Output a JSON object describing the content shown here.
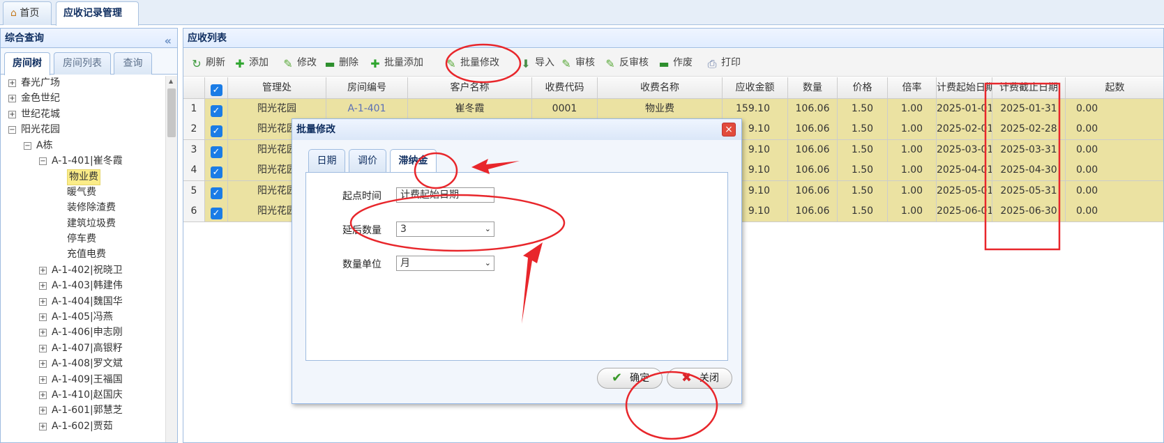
{
  "top_tabs": [
    {
      "label": "首页",
      "icon": "home-icon"
    },
    {
      "label": "应收记录管理",
      "close": "×"
    }
  ],
  "left": {
    "title": "综合查询",
    "collapse": "«",
    "tabs": [
      "房间树",
      "房间列表",
      "查询"
    ],
    "tree": [
      {
        "label": "春光广场",
        "toggle": "+"
      },
      {
        "label": "金色世纪",
        "toggle": "+"
      },
      {
        "label": "世纪花城",
        "toggle": "+"
      },
      {
        "label": "阳光花园",
        "toggle": "−"
      },
      {
        "label": "A栋",
        "toggle": "−"
      },
      {
        "label": "A-1-401|崔冬霞",
        "toggle": "−"
      },
      {
        "label": "物业费",
        "selected": true
      },
      {
        "label": "暖气费"
      },
      {
        "label": "装修除渣费"
      },
      {
        "label": "建筑垃圾费"
      },
      {
        "label": "停车费"
      },
      {
        "label": "充值电费"
      },
      {
        "label": "A-1-402|祝晓卫",
        "toggle": "+"
      },
      {
        "label": "A-1-403|韩建伟",
        "toggle": "+"
      },
      {
        "label": "A-1-404|魏国华",
        "toggle": "+"
      },
      {
        "label": "A-1-405|冯燕",
        "toggle": "+"
      },
      {
        "label": "A-1-406|申志刚",
        "toggle": "+"
      },
      {
        "label": "A-1-407|高银籽",
        "toggle": "+"
      },
      {
        "label": "A-1-408|罗文斌",
        "toggle": "+"
      },
      {
        "label": "A-1-409|王福国",
        "toggle": "+"
      },
      {
        "label": "A-1-410|赵国庆",
        "toggle": "+"
      },
      {
        "label": "A-1-601|郭慧芝",
        "toggle": "+"
      },
      {
        "label": "A-1-602|贾茹",
        "toggle": "+"
      }
    ]
  },
  "right": {
    "title": "应收列表",
    "toolbar": [
      {
        "label": "刷新",
        "icon": "refresh-icon"
      },
      {
        "label": "添加",
        "icon": "add-icon"
      },
      {
        "label": "修改",
        "icon": "edit-icon"
      },
      {
        "label": "删除",
        "icon": "delete-icon"
      },
      {
        "label": "批量添加",
        "icon": "batch-add-icon"
      },
      {
        "label": "批量修改",
        "icon": "batch-edit-icon"
      },
      {
        "label": "导入",
        "icon": "import-icon"
      },
      {
        "label": "审核",
        "icon": "approve-icon"
      },
      {
        "label": "反审核",
        "icon": "unapprove-icon"
      },
      {
        "label": "作废",
        "icon": "void-icon"
      },
      {
        "label": "打印",
        "icon": "print-icon"
      }
    ],
    "columns": [
      "",
      "",
      "管理处",
      "房间编号",
      "客户名称",
      "收费代码",
      "收费名称",
      "应收金额",
      "数量",
      "价格",
      "倍率",
      "计费起始日期",
      "计费截止日期",
      "起数"
    ],
    "rows": [
      [
        "1",
        "阳光花园",
        "A-1-401",
        "崔冬霞",
        "0001",
        "物业费",
        "159.10",
        "106.06",
        "1.50",
        "1.00",
        "2025-01-01",
        "2025-01-31",
        "0.00"
      ],
      [
        "2",
        "阳光花园",
        "",
        "",
        "",
        "",
        "9.10",
        "106.06",
        "1.50",
        "1.00",
        "2025-02-01",
        "2025-02-28",
        "0.00"
      ],
      [
        "3",
        "阳光花园",
        "",
        "",
        "",
        "",
        "9.10",
        "106.06",
        "1.50",
        "1.00",
        "2025-03-01",
        "2025-03-31",
        "0.00"
      ],
      [
        "4",
        "阳光花园",
        "",
        "",
        "",
        "",
        "9.10",
        "106.06",
        "1.50",
        "1.00",
        "2025-04-01",
        "2025-04-30",
        "0.00"
      ],
      [
        "5",
        "阳光花园",
        "",
        "",
        "",
        "",
        "9.10",
        "106.06",
        "1.50",
        "1.00",
        "2025-05-01",
        "2025-05-31",
        "0.00"
      ],
      [
        "6",
        "阳光花园",
        "",
        "",
        "",
        "",
        "9.10",
        "106.06",
        "1.50",
        "1.00",
        "2025-06-01",
        "2025-06-30",
        "0.00"
      ]
    ]
  },
  "dialog": {
    "title": "批量修改",
    "close": "×",
    "tabs": [
      "日期",
      "调价",
      "滞纳金"
    ],
    "fields": [
      {
        "label": "起点时间",
        "value": "计费起始日期"
      },
      {
        "label": "延后数量",
        "value": "3"
      },
      {
        "label": "数量单位",
        "value": "月"
      }
    ],
    "ok": "确定",
    "cancel": "关闭"
  },
  "colors": {
    "annotation": "#e8262b",
    "row_highlight": "#ebe2a2",
    "checkbox": "#1a7ce6"
  }
}
